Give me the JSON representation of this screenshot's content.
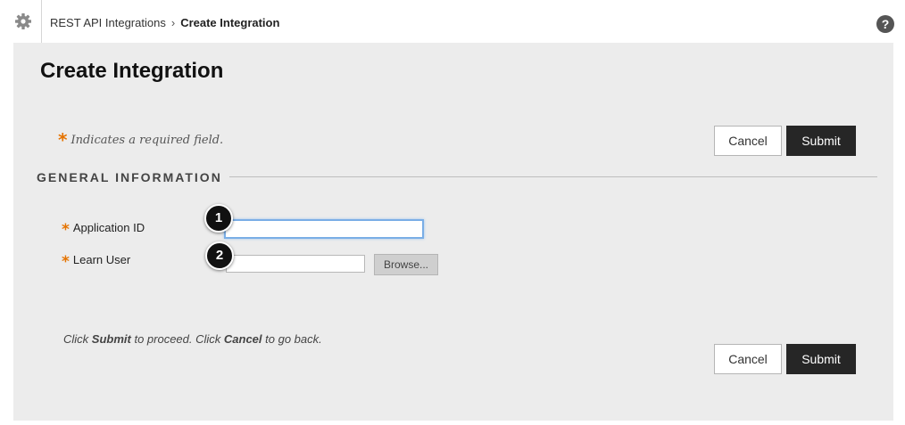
{
  "header": {
    "breadcrumb_parent": "REST API Integrations",
    "breadcrumb_separator": "›",
    "breadcrumb_current": "Create Integration",
    "settings_icon": "gear-icon",
    "help_icon": "help-icon",
    "help_glyph": "?"
  },
  "page": {
    "title": "Create Integration",
    "required_star": "*",
    "required_note": "Indicates a required field."
  },
  "buttons": {
    "cancel_label": "Cancel",
    "submit_label": "Submit"
  },
  "section": {
    "title": "GENERAL INFORMATION"
  },
  "fields": {
    "application_id": {
      "label": "Application ID",
      "value": "",
      "required": true
    },
    "learn_user": {
      "label": "Learn User",
      "value": "",
      "required": true,
      "browse_label": "Browse..."
    }
  },
  "callouts": [
    "1",
    "2"
  ],
  "footer": {
    "pre": "Click ",
    "submit_word": "Submit",
    "mid": " to proceed. Click ",
    "cancel_word": "Cancel",
    "post": " to go back."
  },
  "colors": {
    "required_star": "#e57300",
    "submit_bg": "#262626",
    "panel_bg": "#ececec",
    "focus_border": "#7aaee6"
  }
}
